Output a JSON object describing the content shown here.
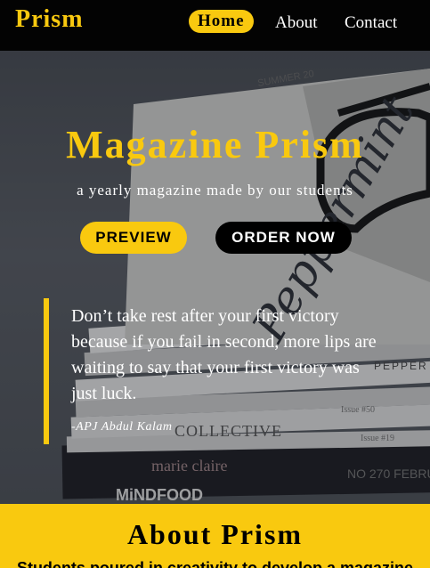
{
  "nav": {
    "brand": "Prism",
    "links": [
      {
        "label": "Home",
        "active": true
      },
      {
        "label": "About",
        "active": false
      },
      {
        "label": "Contact",
        "active": false
      }
    ]
  },
  "hero": {
    "title": "Magazine Prism",
    "subtitle": "a yearly magazine made by our students",
    "preview_button": "PREVIEW",
    "order_button": "ORDER NOW",
    "quote": "Don’t take rest after your first victory because if you fail in second, more lips are waiting to say that your first victory was just luck.",
    "quote_author": "-APJ Abdul Kalam",
    "background_texts": {
      "cover_word": "Peppermint",
      "summer_label": "SUMMER 20",
      "pepper_label": "PEPPER",
      "issue_50": "Issue #50",
      "collective": "COLLECTIVE",
      "issue_19": "Issue #19",
      "marie_claire": "marie claire",
      "no_270": "NO 270 FEBRU",
      "mindfood": "MiNDFOOD"
    }
  },
  "about": {
    "title": "About Prism",
    "text": "Students poured in creativity to develop a magazine"
  },
  "colors": {
    "accent": "#f9c90f",
    "nav_bg": "#030303",
    "text_light": "#ffffff"
  }
}
